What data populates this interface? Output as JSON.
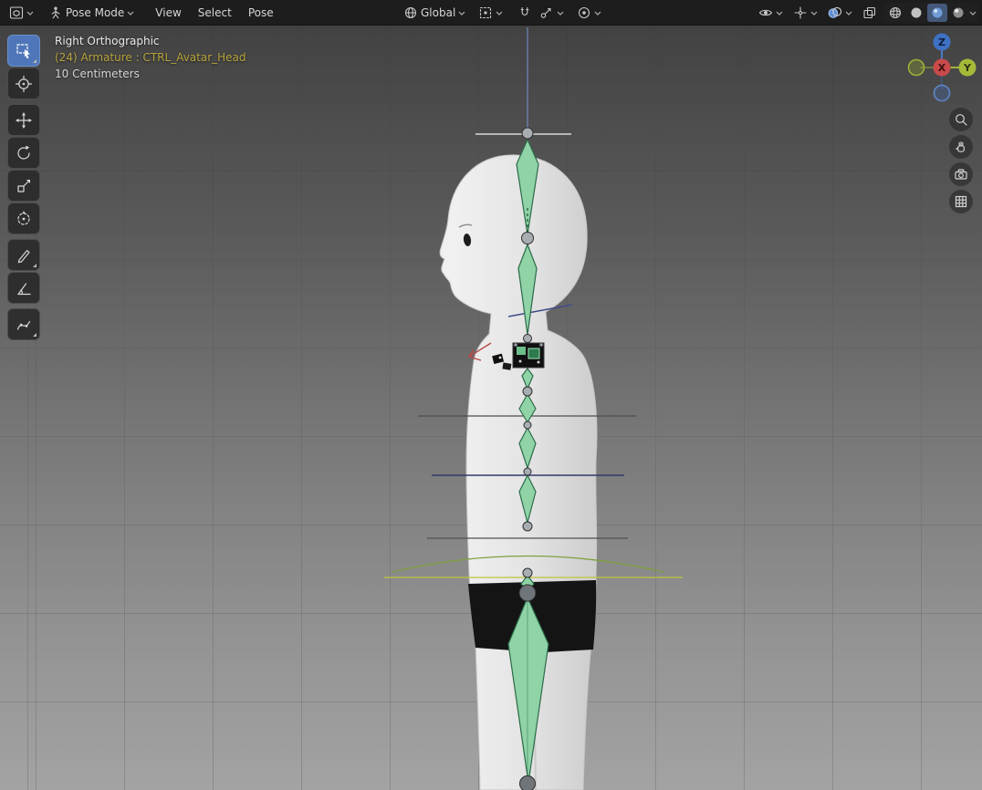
{
  "header": {
    "editor": {
      "icon": "editor-type-3d-viewport-icon"
    },
    "mode": {
      "label": "Pose Mode",
      "icon": "pose-mode-icon"
    },
    "menus": [
      {
        "label": "View"
      },
      {
        "label": "Select"
      },
      {
        "label": "Pose"
      }
    ],
    "transform": {
      "orientation_label": "Global",
      "orientation_icon": "orientation-global-icon",
      "pivot_icon": "pivot-point-icon",
      "snap_icon": "snap-magnet-icon",
      "snap_target_icon": "snap-with-icon",
      "proportional_icon": "proportional-editing-icon"
    },
    "right": {
      "visibility_icon": "object-visibility-icon",
      "gizmo_icon": "show-gizmos-icon",
      "overlays_icon": "show-overlays-icon",
      "xray_icon": "toggle-xray-icon",
      "shading_modes": [
        {
          "name": "wireframe",
          "active": false
        },
        {
          "name": "solid",
          "active": false
        },
        {
          "name": "material-preview",
          "active": true
        },
        {
          "name": "rendered",
          "active": false
        }
      ]
    }
  },
  "toolbar": {
    "tools": [
      {
        "name": "select-box",
        "active": true
      },
      {
        "name": "cursor",
        "active": false
      },
      {
        "name": "move",
        "active": false
      },
      {
        "name": "rotate",
        "active": false
      },
      {
        "name": "scale",
        "active": false
      },
      {
        "name": "transform",
        "active": false
      },
      {
        "name": "annotate",
        "active": false
      },
      {
        "name": "measure",
        "active": false
      },
      {
        "name": "pose-breakdowner",
        "active": false
      }
    ]
  },
  "viewport": {
    "text_overlay": {
      "view_label": "Right Orthographic",
      "object_label": "(24) Armature : CTRL_Avatar_Head",
      "scale_label": "10 Centimeters"
    },
    "axis_gizmo": {
      "z_label": "Z",
      "x_label": "X",
      "y_label": "Y"
    },
    "nav_buttons": [
      "zoom",
      "pan",
      "camera-view",
      "toggle-orthographic"
    ],
    "scene": {
      "model": "humanoid-avatar-side-view",
      "armature": "CTRL_Avatar_Head",
      "selected_bone_count": 24
    }
  },
  "colors": {
    "accent_blue": "#4f76b8",
    "bone_green": "#8fd3a6",
    "bone_outline_green": "#2c6b49",
    "object_text_yellow": "#b5a33c",
    "axis_x_red": "#c84a4a",
    "axis_y_green": "#a6b939",
    "axis_z_blue": "#3e71c4",
    "viewport_top": "#424242",
    "viewport_bottom": "#a3a3a3"
  }
}
